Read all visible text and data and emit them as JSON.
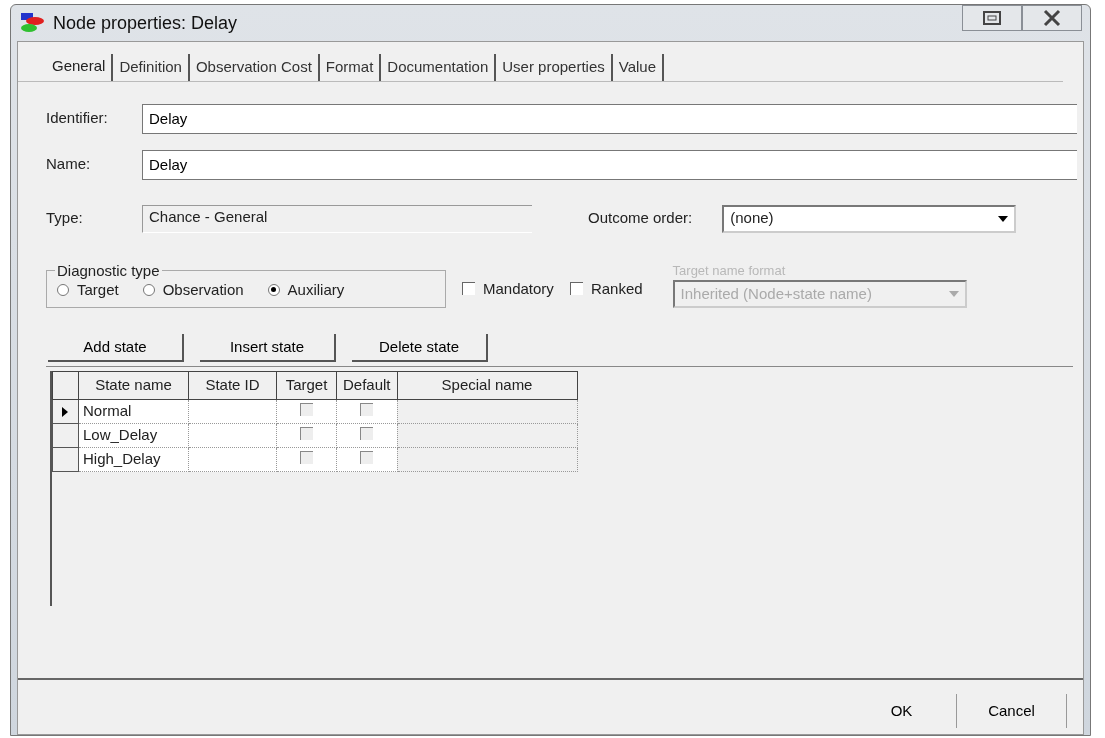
{
  "window": {
    "title": "Node properties: Delay"
  },
  "tabs": [
    {
      "label": "General",
      "selected": true
    },
    {
      "label": "Definition",
      "selected": false
    },
    {
      "label": "Observation Cost",
      "selected": false
    },
    {
      "label": "Format",
      "selected": false
    },
    {
      "label": "Documentation",
      "selected": false
    },
    {
      "label": "User properties",
      "selected": false
    },
    {
      "label": "Value",
      "selected": false
    }
  ],
  "identifier": {
    "label": "Identifier:",
    "value": "Delay"
  },
  "name": {
    "label": "Name:",
    "value": "Delay"
  },
  "type": {
    "label": "Type:",
    "value": "Chance - General"
  },
  "outcome_order": {
    "label": "Outcome order:",
    "value": "(none)"
  },
  "diagnostic_type": {
    "legend": "Diagnostic type",
    "options": [
      {
        "label": "Target",
        "selected": false
      },
      {
        "label": "Observation",
        "selected": false
      },
      {
        "label": "Auxiliary",
        "selected": true
      }
    ]
  },
  "flags": [
    {
      "label": "Mandatory",
      "checked": false
    },
    {
      "label": "Ranked",
      "checked": false
    }
  ],
  "target_name_format": {
    "label": "Target name format",
    "value": "Inherited (Node+state name)",
    "disabled": true
  },
  "state_buttons": [
    "Add state",
    "Insert state",
    "Delete state"
  ],
  "table": {
    "columns": [
      "State name",
      "State ID",
      "Target",
      "Default",
      "Special name"
    ],
    "rows": [
      {
        "state_name": "Normal",
        "selected": true,
        "target": false,
        "default": false
      },
      {
        "state_name": "Low_Delay",
        "selected": false,
        "target": false,
        "default": false
      },
      {
        "state_name": "High_Delay",
        "selected": false,
        "target": false,
        "default": false
      }
    ]
  },
  "dialog_buttons": [
    "OK",
    "Cancel"
  ]
}
